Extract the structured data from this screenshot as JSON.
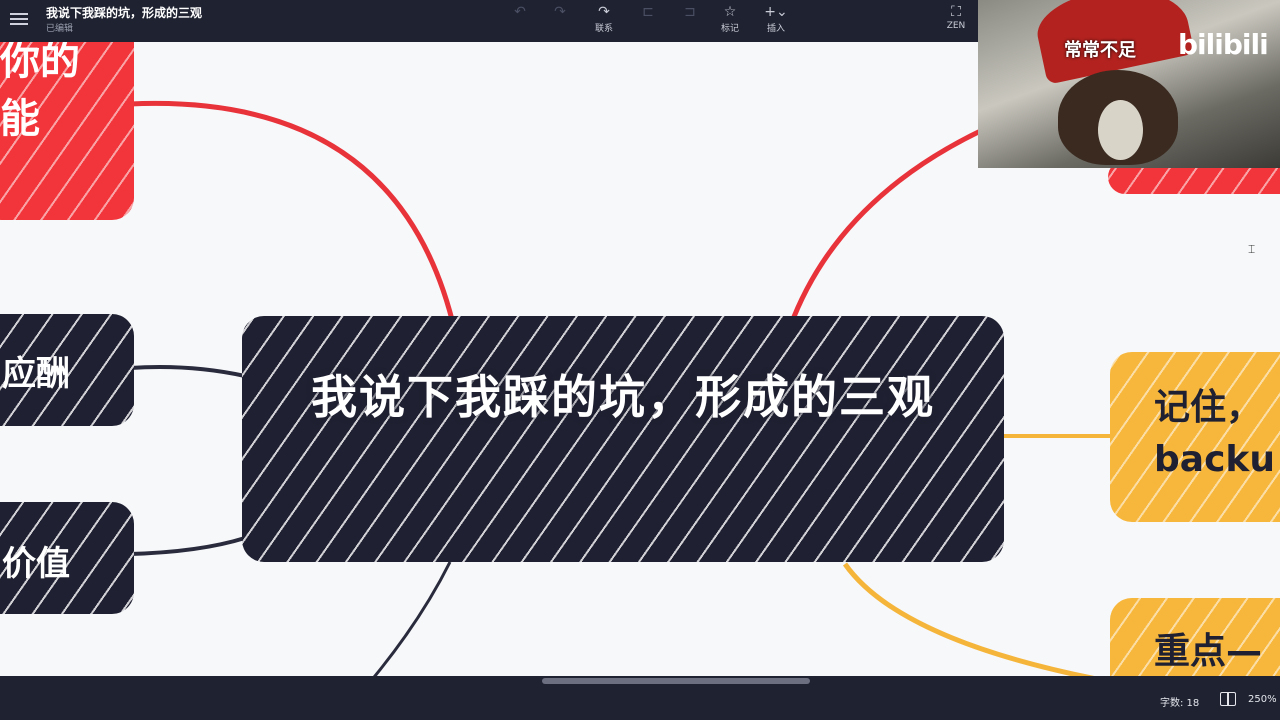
{
  "topbar": {
    "title": "我说下我踩的坑，形成的三观",
    "status": "已编辑",
    "tools": [
      {
        "label": "联系",
        "icon": "↷"
      },
      {
        "label": "标记",
        "icon": "☆"
      },
      {
        "label": "插入",
        "icon": "+⌄"
      },
      {
        "label": "ZEN",
        "icon": "⛶"
      }
    ]
  },
  "mindmap": {
    "central": "我说下我踩的坑，形成的三观",
    "left_nodes": [
      {
        "text_line1": "你的",
        "text_line2": "能"
      },
      {
        "text": "应酬"
      },
      {
        "text": "价值"
      }
    ],
    "right_nodes": [
      {
        "text_line1": "记住，",
        "text_line2": "backu"
      },
      {
        "text": "重点—"
      }
    ],
    "colors": {
      "central": "#1f2031",
      "red": "#f2353b",
      "yellow": "#f7b73c",
      "edge_red": "#e8333a",
      "edge_dark": "#2a2c3d",
      "edge_yellow": "#f5b53a"
    }
  },
  "webcam": {
    "caption": "常常不足",
    "brand": "bilibili"
  },
  "statusbar": {
    "word_count": "字数: 18",
    "zoom": "250%"
  }
}
